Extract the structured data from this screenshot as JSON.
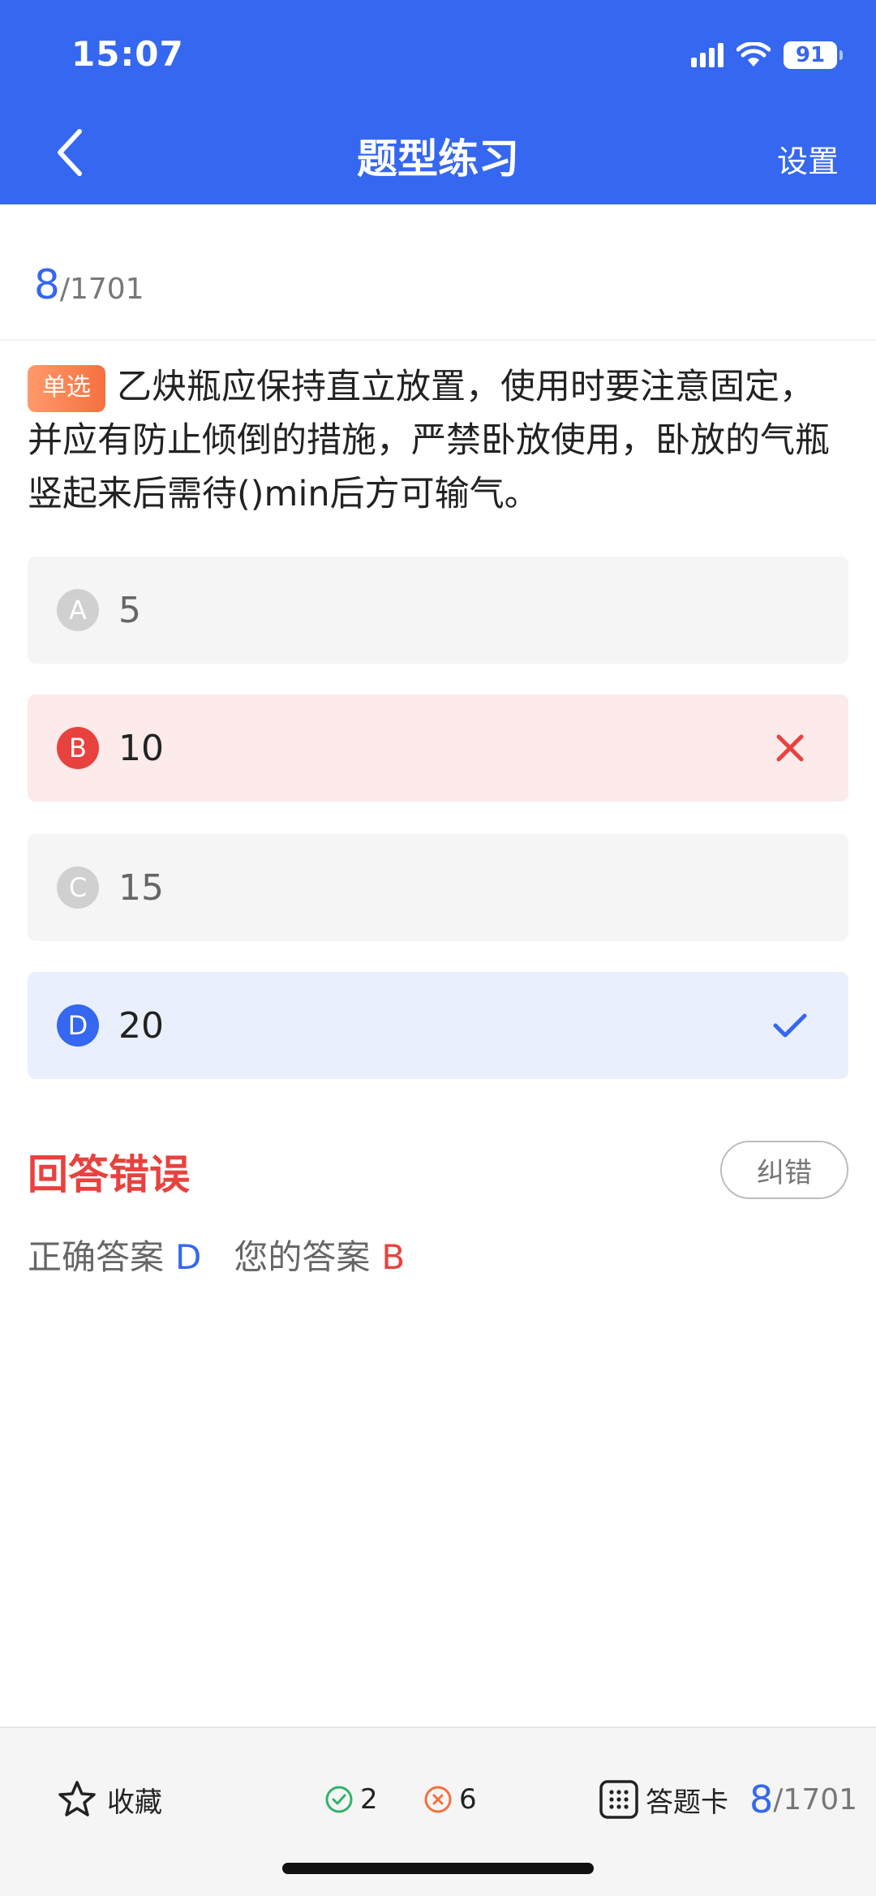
{
  "status_bar": {
    "time": "15:07",
    "battery": "91",
    "icons": [
      "signal-icon",
      "wifi-icon",
      "battery-icon"
    ]
  },
  "nav": {
    "title": "题型练习",
    "settings_label": "设置",
    "back_icon": "chevron-left-icon"
  },
  "progress": {
    "current": "8",
    "total": "/1701"
  },
  "question": {
    "type_tag": "单选",
    "text": "乙炔瓶应保持直立放置，使用时要注意固定，并应有防止倾倒的措施，严禁卧放使用，卧放的气瓶竖起来后需待()min后方可输气。"
  },
  "options": [
    {
      "letter": "A",
      "text": "5",
      "state": "neutral"
    },
    {
      "letter": "B",
      "text": "10",
      "state": "wrong"
    },
    {
      "letter": "C",
      "text": "15",
      "state": "neutral"
    },
    {
      "letter": "D",
      "text": "20",
      "state": "correct"
    }
  ],
  "result": {
    "title": "回答错误",
    "report_label": "纠错",
    "correct_label": "正确答案",
    "correct_value": "D",
    "yours_label": "您的答案",
    "yours_value": "B"
  },
  "bottom_bar": {
    "favorite_label": "收藏",
    "right_count": "2",
    "wrong_count": "6",
    "card_label": "答题卡",
    "progress_current": "8",
    "progress_total": "/1701"
  },
  "colors": {
    "primary": "#3567f0",
    "error": "#e8423e",
    "success": "#2fb36a",
    "tag": "#f5703f"
  }
}
